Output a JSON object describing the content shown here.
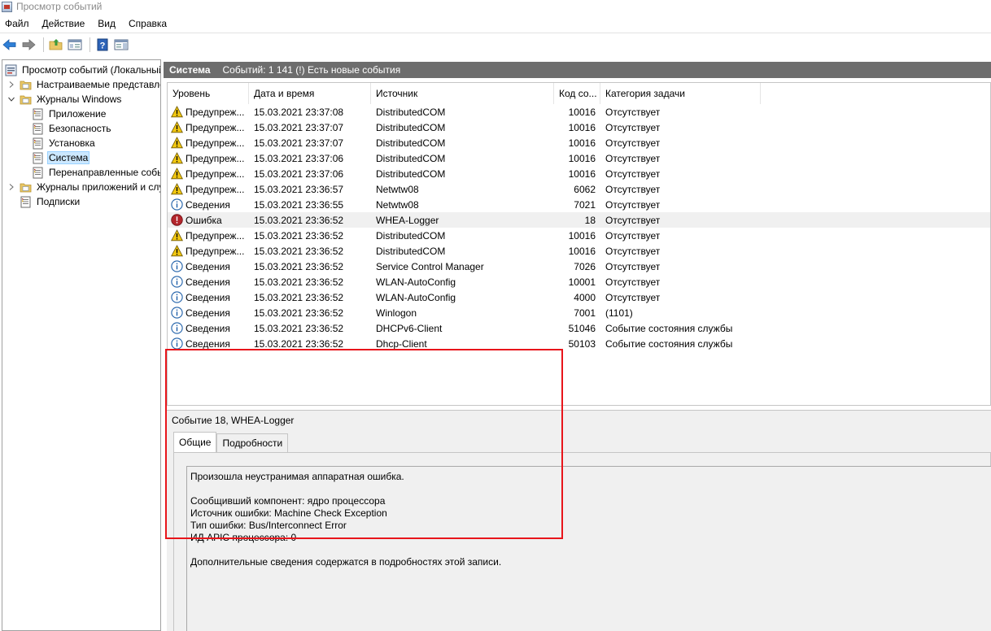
{
  "window": {
    "title": "Просмотр событий"
  },
  "menu": [
    "Файл",
    "Действие",
    "Вид",
    "Справка"
  ],
  "toolbar": {
    "icons": [
      "back-arrow-icon",
      "forward-arrow-icon",
      "folder-up-icon",
      "show-hide-tree-icon",
      "help-icon",
      "properties-pane-icon"
    ]
  },
  "tree": {
    "root": "Просмотр событий (Локальный)",
    "items": [
      {
        "label": "Настраиваемые представления",
        "level": 1,
        "twisty": "collapsed",
        "icon": "folder-icon"
      },
      {
        "label": "Журналы Windows",
        "level": 1,
        "twisty": "expanded",
        "icon": "folder-icon"
      },
      {
        "label": "Приложение",
        "level": 2,
        "twisty": "none",
        "icon": "log-icon"
      },
      {
        "label": "Безопасность",
        "level": 2,
        "twisty": "none",
        "icon": "log-icon"
      },
      {
        "label": "Установка",
        "level": 2,
        "twisty": "none",
        "icon": "log-icon"
      },
      {
        "label": "Система",
        "level": 2,
        "twisty": "none",
        "icon": "log-icon",
        "selected": true
      },
      {
        "label": "Перенаправленные события",
        "level": 2,
        "twisty": "none",
        "icon": "log-icon"
      },
      {
        "label": "Журналы приложений и служб",
        "level": 1,
        "twisty": "collapsed",
        "icon": "folder-icon"
      },
      {
        "label": "Подписки",
        "level": 1,
        "twisty": "none",
        "icon": "log-icon"
      }
    ]
  },
  "header": {
    "title": "Система",
    "info": "Событий: 1 141 (!) Есть новые события"
  },
  "columns": [
    "Уровень",
    "Дата и время",
    "Источник",
    "Код со...",
    "Категория задачи"
  ],
  "events": [
    {
      "level": "warning",
      "level_label": "Предупреж...",
      "datetime": "15.03.2021 23:37:08",
      "source": "DistributedCOM",
      "code": "10016",
      "category": "Отсутствует"
    },
    {
      "level": "warning",
      "level_label": "Предупреж...",
      "datetime": "15.03.2021 23:37:07",
      "source": "DistributedCOM",
      "code": "10016",
      "category": "Отсутствует"
    },
    {
      "level": "warning",
      "level_label": "Предупреж...",
      "datetime": "15.03.2021 23:37:07",
      "source": "DistributedCOM",
      "code": "10016",
      "category": "Отсутствует"
    },
    {
      "level": "warning",
      "level_label": "Предупреж...",
      "datetime": "15.03.2021 23:37:06",
      "source": "DistributedCOM",
      "code": "10016",
      "category": "Отсутствует"
    },
    {
      "level": "warning",
      "level_label": "Предупреж...",
      "datetime": "15.03.2021 23:37:06",
      "source": "DistributedCOM",
      "code": "10016",
      "category": "Отсутствует"
    },
    {
      "level": "warning",
      "level_label": "Предупреж...",
      "datetime": "15.03.2021 23:36:57",
      "source": "Netwtw08",
      "code": "6062",
      "category": "Отсутствует"
    },
    {
      "level": "info",
      "level_label": "Сведения",
      "datetime": "15.03.2021 23:36:55",
      "source": "Netwtw08",
      "code": "7021",
      "category": "Отсутствует"
    },
    {
      "level": "error",
      "level_label": "Ошибка",
      "datetime": "15.03.2021 23:36:52",
      "source": "WHEA-Logger",
      "code": "18",
      "category": "Отсутствует",
      "selected": true
    },
    {
      "level": "warning",
      "level_label": "Предупреж...",
      "datetime": "15.03.2021 23:36:52",
      "source": "DistributedCOM",
      "code": "10016",
      "category": "Отсутствует"
    },
    {
      "level": "warning",
      "level_label": "Предупреж...",
      "datetime": "15.03.2021 23:36:52",
      "source": "DistributedCOM",
      "code": "10016",
      "category": "Отсутствует"
    },
    {
      "level": "info",
      "level_label": "Сведения",
      "datetime": "15.03.2021 23:36:52",
      "source": "Service Control Manager",
      "code": "7026",
      "category": "Отсутствует"
    },
    {
      "level": "info",
      "level_label": "Сведения",
      "datetime": "15.03.2021 23:36:52",
      "source": "WLAN-AutoConfig",
      "code": "10001",
      "category": "Отсутствует"
    },
    {
      "level": "info",
      "level_label": "Сведения",
      "datetime": "15.03.2021 23:36:52",
      "source": "WLAN-AutoConfig",
      "code": "4000",
      "category": "Отсутствует"
    },
    {
      "level": "info",
      "level_label": "Сведения",
      "datetime": "15.03.2021 23:36:52",
      "source": "Winlogon",
      "code": "7001",
      "category": "(1101)"
    },
    {
      "level": "info",
      "level_label": "Сведения",
      "datetime": "15.03.2021 23:36:52",
      "source": "DHCPv6-Client",
      "code": "51046",
      "category": "Событие состояния службы"
    },
    {
      "level": "info",
      "level_label": "Сведения",
      "datetime": "15.03.2021 23:36:52",
      "source": "Dhcp-Client",
      "code": "50103",
      "category": "Событие состояния службы"
    }
  ],
  "details": {
    "title": "Событие 18, WHEA-Logger",
    "tabs": [
      "Общие",
      "Подробности"
    ],
    "active_tab": "Общие",
    "message": [
      "Произошла неустранимая аппаратная ошибка.",
      "",
      "Сообщивший компонент: ядро процессора",
      "Источник ошибки: Machine Check Exception",
      "Тип ошибки: Bus/Interconnect Error",
      "ИД APIC процессора: 0",
      "",
      "Дополнительные сведения содержатся в подробностях этой записи."
    ]
  },
  "colors": {
    "header_band": "#6d6d6d",
    "selection": "#cce8ff",
    "highlight_box": "#e8151b",
    "warning": "#f2c811",
    "error": "#b3262c",
    "info": "#1e5fa8"
  }
}
